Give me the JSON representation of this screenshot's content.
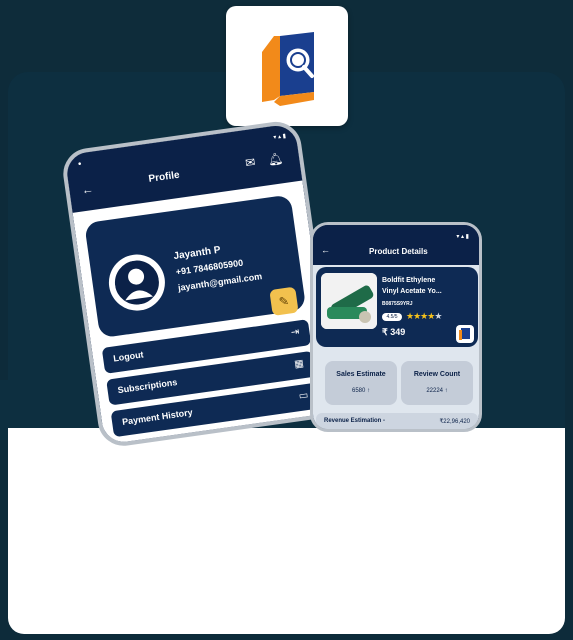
{
  "profile_phone": {
    "header_title": "Profile",
    "user": {
      "name": "Jayanth P",
      "phone": "+91 7846805900",
      "email": "jayanth@gmail.com"
    },
    "menu": [
      {
        "label": "Logout",
        "icon": "logout-icon"
      },
      {
        "label": "Subscriptions",
        "icon": "grid-icon"
      },
      {
        "label": "Payment History",
        "icon": "card-icon"
      }
    ]
  },
  "product_phone": {
    "header_title": "Product Details",
    "product": {
      "name_line1": "Boldfit Ethylene",
      "name_line2": "Vinyl Acetate Yo...",
      "code": "B0875S9YRJ",
      "rating": "4.5/5",
      "stars_filled": 4,
      "price": "₹ 349"
    },
    "stats": [
      {
        "title": "Sales Estimate",
        "value": "6580 ↑"
      },
      {
        "title": "Review Count",
        "value": "22224 ↑"
      }
    ],
    "revenue": {
      "label": "Revenue Estimation -",
      "value": "₹22,96,420"
    }
  },
  "colors": {
    "navy": "#0b2148",
    "panel": "#0d2f40",
    "accent_orange": "#f28a1a",
    "accent_blue": "#1a3f8f",
    "star": "#f6c21b",
    "edit": "#f2c14e"
  }
}
